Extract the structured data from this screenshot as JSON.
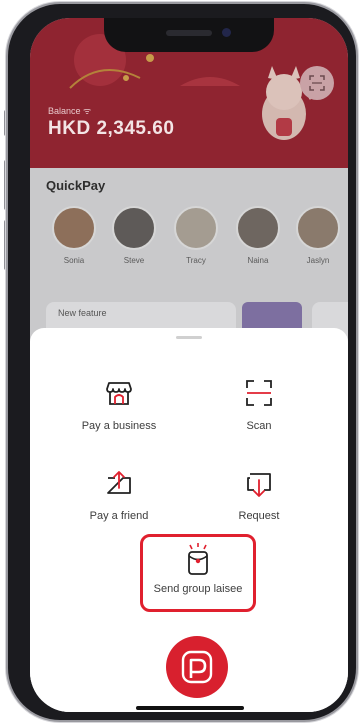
{
  "header": {
    "balance_label": "Balance ᯤ",
    "balance_value": "HKD 2,345.60",
    "scan_icon": "scan-icon"
  },
  "quickpay": {
    "title": "QuickPay",
    "contacts": [
      {
        "name": "Sonia"
      },
      {
        "name": "Steve"
      },
      {
        "name": "Tracy"
      },
      {
        "name": "Naina"
      },
      {
        "name": "Jaslyn"
      }
    ]
  },
  "feature_card": {
    "label": "New feature"
  },
  "sheet": {
    "actions": [
      {
        "label": "Pay a business",
        "icon": "storefront-icon"
      },
      {
        "label": "Scan",
        "icon": "scan-icon"
      },
      {
        "label": "Pay a friend",
        "icon": "send-money-icon"
      },
      {
        "label": "Request",
        "icon": "request-money-icon"
      }
    ],
    "laisee": {
      "label": "Send group laisee",
      "icon": "red-packet-icon"
    },
    "fab_icon": "payme-logo-icon"
  },
  "colors": {
    "brand_red": "#d8202e",
    "highlight_red": "#e0202e",
    "header_dim": "#8f2430"
  }
}
